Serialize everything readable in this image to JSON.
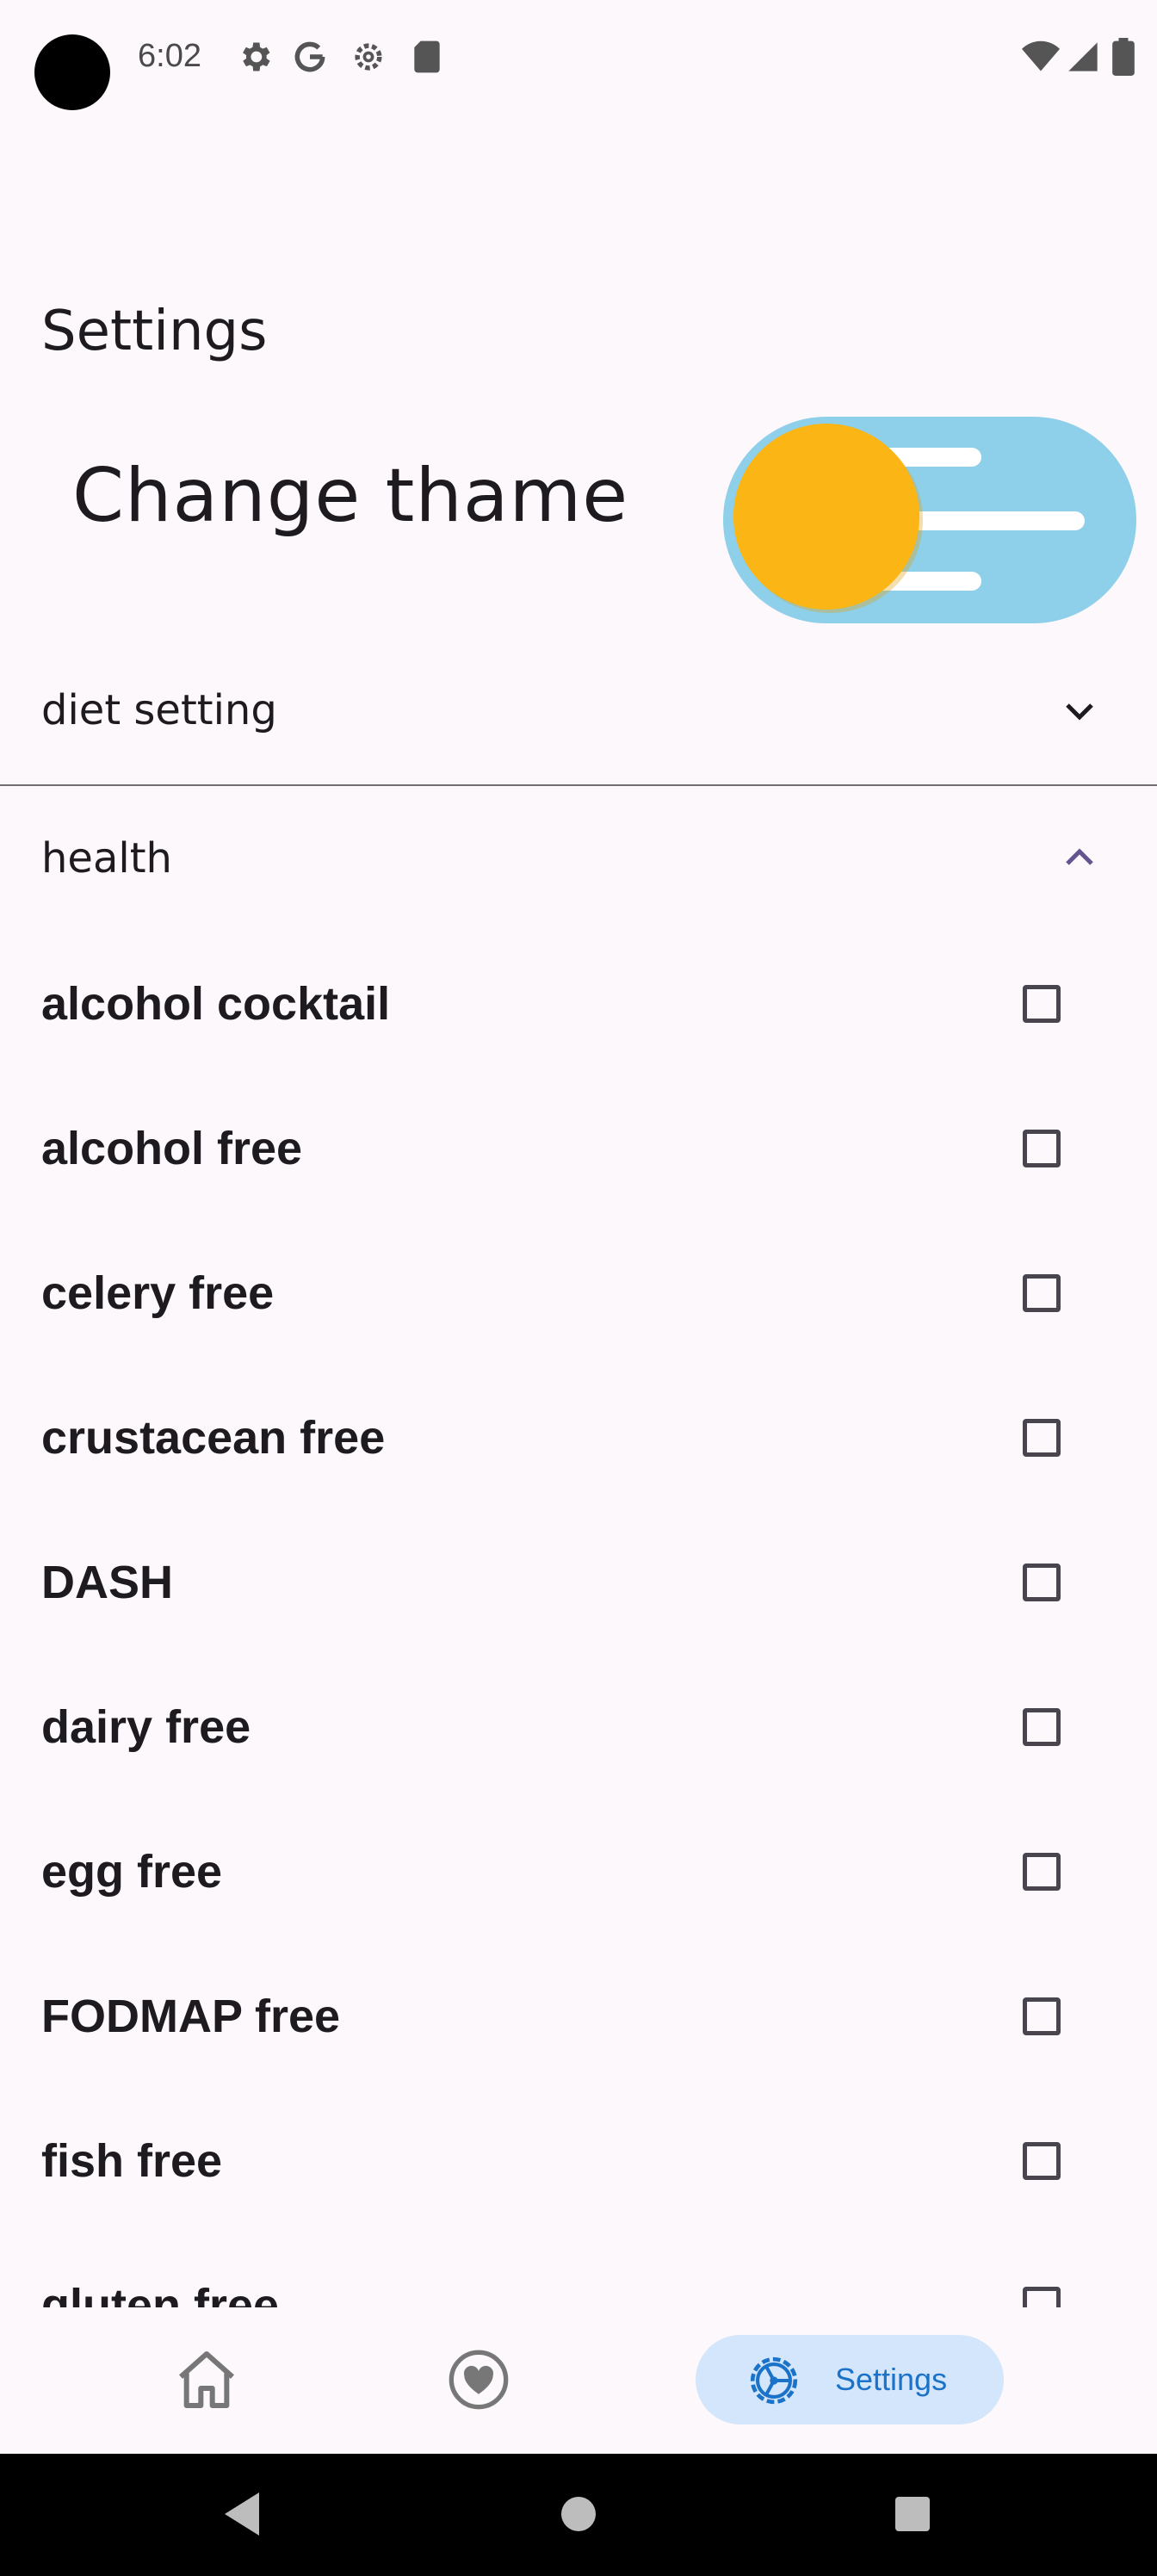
{
  "status_bar": {
    "time": "6:02",
    "left_icons": [
      "gear-icon",
      "google-icon",
      "settings-outline-icon",
      "sd-card-icon"
    ],
    "right_icons": [
      "wifi-icon",
      "signal-icon",
      "battery-icon"
    ]
  },
  "page": {
    "title": "Settings"
  },
  "theme": {
    "label": "Change thame",
    "toggle_state": "light",
    "colors": {
      "sky": "#8ecfea",
      "sun": "#fbb615"
    }
  },
  "diet_section": {
    "label": "diet setting",
    "expanded": false
  },
  "health_section": {
    "label": "health",
    "expanded": true,
    "items": [
      {
        "label": "alcohol cocktail",
        "checked": false
      },
      {
        "label": "alcohol free",
        "checked": false
      },
      {
        "label": "celery free",
        "checked": false
      },
      {
        "label": "crustacean free",
        "checked": false
      },
      {
        "label": "DASH",
        "checked": false
      },
      {
        "label": "dairy free",
        "checked": false
      },
      {
        "label": "egg free",
        "checked": false
      },
      {
        "label": "FODMAP free",
        "checked": false
      },
      {
        "label": "fish free",
        "checked": false
      },
      {
        "label": "gluten free",
        "checked": false
      }
    ]
  },
  "bottom_nav": {
    "items": [
      {
        "icon": "home-icon",
        "label": ""
      },
      {
        "icon": "heart-icon",
        "label": ""
      },
      {
        "icon": "settings-icon",
        "label": "Settings",
        "selected": true
      }
    ],
    "accent": "#1a73c8",
    "selected_bg": "#d3e6fb"
  },
  "system_nav": {
    "buttons": [
      "back-icon",
      "home-circle-icon",
      "recents-icon"
    ]
  }
}
